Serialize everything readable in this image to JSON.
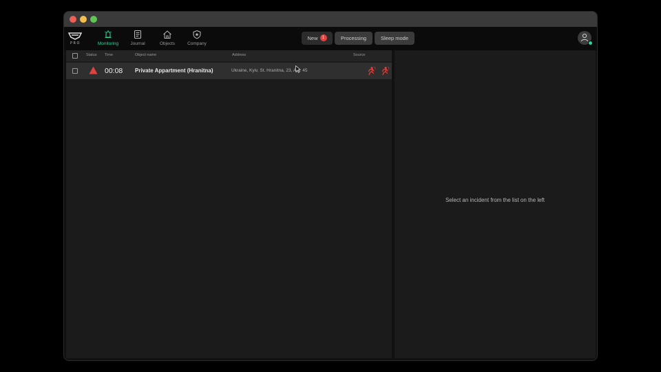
{
  "window": {
    "traffic_lights": [
      "close",
      "minimize",
      "zoom"
    ]
  },
  "brand": {
    "logo_text": "PRO"
  },
  "nav": {
    "items": [
      {
        "label": "Monitoring",
        "icon": "alarm-bell-icon",
        "active": true
      },
      {
        "label": "Journal",
        "icon": "journal-icon",
        "active": false
      },
      {
        "label": "Objects",
        "icon": "house-icon",
        "active": false
      },
      {
        "label": "Company",
        "icon": "shield-icon",
        "active": false
      }
    ]
  },
  "tabs": {
    "new_label": "New",
    "new_count": "1",
    "processing_label": "Processing",
    "sleep_label": "Sleep mode"
  },
  "table": {
    "columns": {
      "status": "Status",
      "time": "Time",
      "object_name": "Object name",
      "address": "Address",
      "source": "Source"
    },
    "rows": [
      {
        "status_icon": "alarm-triangle-icon",
        "time": "00:08",
        "object_name": "Private Appartment (Hranitna)",
        "address": "Ukraine, Kyiv, St. Hranitna, 23, Apt. 45",
        "source_icons": [
          "motion-detector-icon",
          "motion-detector-icon"
        ]
      }
    ]
  },
  "detail": {
    "empty_message": "Select an incident from the list on the left"
  },
  "colors": {
    "accent": "#2fd29a",
    "alarm": "#e0433f",
    "background": "#111111",
    "panel": "#1b1b1b",
    "row_highlight": "#2f2f2f"
  }
}
